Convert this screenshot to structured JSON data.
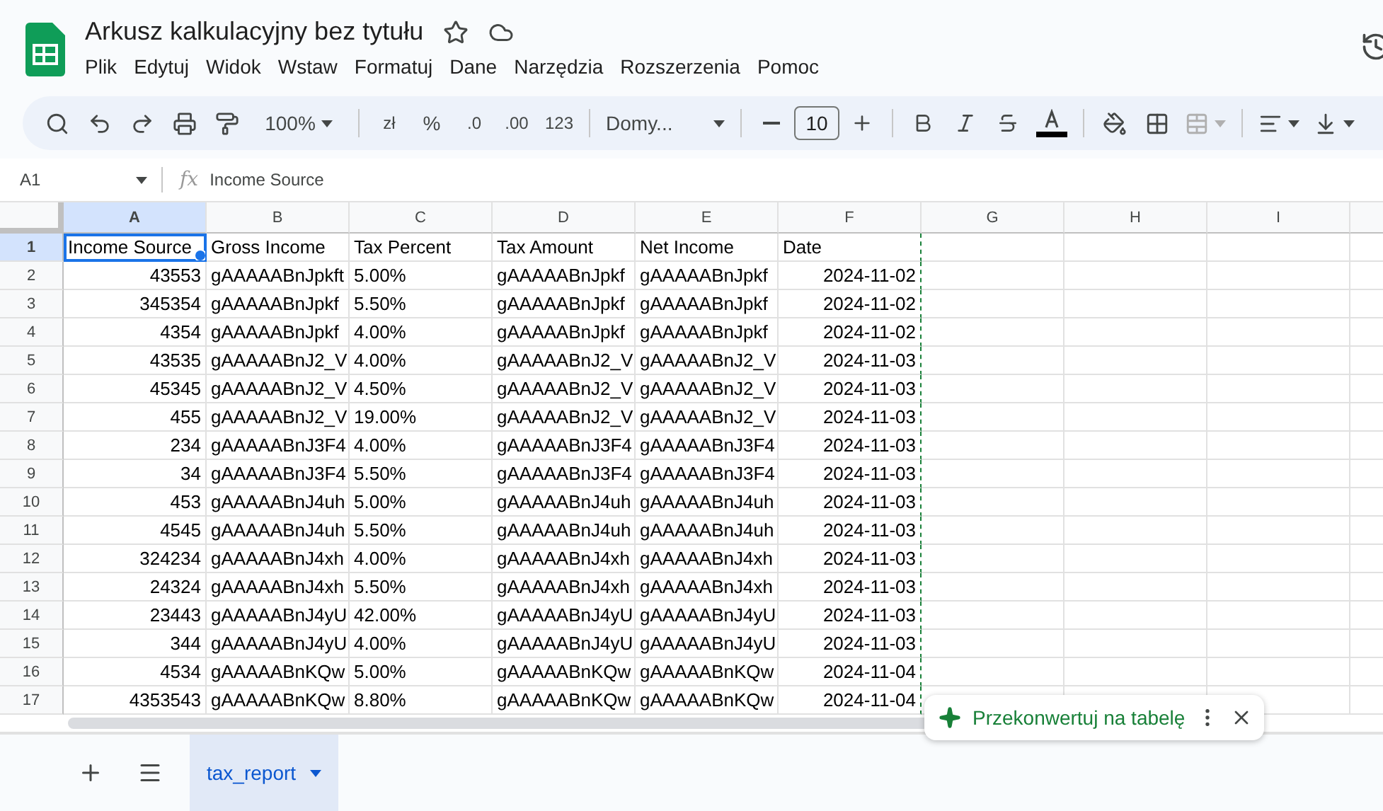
{
  "document": {
    "title": "Arkusz kalkulacyjny bez tytułu"
  },
  "menu": [
    "Plik",
    "Edytuj",
    "Widok",
    "Wstaw",
    "Formatuj",
    "Dane",
    "Narzędzia",
    "Rozszerzenia",
    "Pomoc"
  ],
  "toolbar": {
    "zoom": "100%",
    "currency": "zł",
    "percent": "%",
    "decrease_decimals": ".0",
    "increase_decimals": ".00",
    "number_format": "123",
    "font": "Domy...",
    "font_size": "10"
  },
  "formula_bar": {
    "cell_ref": "A1",
    "function_label": "fx",
    "formula": "Income Source"
  },
  "grid": {
    "columns": [
      {
        "label": "A",
        "selected": true
      },
      {
        "label": "B",
        "selected": false
      },
      {
        "label": "C",
        "selected": false
      },
      {
        "label": "D",
        "selected": false
      },
      {
        "label": "E",
        "selected": false
      },
      {
        "label": "F",
        "selected": false
      },
      {
        "label": "G",
        "selected": false
      },
      {
        "label": "H",
        "selected": false
      },
      {
        "label": "I",
        "selected": false
      }
    ],
    "rows": [
      {
        "number": "1",
        "selected": true,
        "cells": [
          {
            "text": "Income Source",
            "kind": "text"
          },
          {
            "text": "Gross Income",
            "kind": "text"
          },
          {
            "text": "Tax Percent",
            "kind": "text"
          },
          {
            "text": "Tax Amount",
            "kind": "text"
          },
          {
            "text": "Net Income",
            "kind": "text"
          },
          {
            "text": "Date",
            "kind": "text"
          }
        ]
      },
      {
        "number": "2",
        "selected": false,
        "cells": [
          {
            "text": "43553",
            "kind": "number"
          },
          {
            "text": "gAAAAABnJpkft",
            "kind": "text"
          },
          {
            "text": "5.00%",
            "kind": "text"
          },
          {
            "text": "gAAAAABnJpkf",
            "kind": "text"
          },
          {
            "text": "gAAAAABnJpkf",
            "kind": "text"
          },
          {
            "text": "2024-11-02",
            "kind": "number"
          }
        ]
      },
      {
        "number": "3",
        "selected": false,
        "cells": [
          {
            "text": "345354",
            "kind": "number"
          },
          {
            "text": "gAAAAABnJpkf",
            "kind": "text"
          },
          {
            "text": "5.50%",
            "kind": "text"
          },
          {
            "text": "gAAAAABnJpkf",
            "kind": "text"
          },
          {
            "text": "gAAAAABnJpkf",
            "kind": "text"
          },
          {
            "text": "2024-11-02",
            "kind": "number"
          }
        ]
      },
      {
        "number": "4",
        "selected": false,
        "cells": [
          {
            "text": "4354",
            "kind": "number"
          },
          {
            "text": "gAAAAABnJpkf",
            "kind": "text"
          },
          {
            "text": "4.00%",
            "kind": "text"
          },
          {
            "text": "gAAAAABnJpkf",
            "kind": "text"
          },
          {
            "text": "gAAAAABnJpkf",
            "kind": "text"
          },
          {
            "text": "2024-11-02",
            "kind": "number"
          }
        ]
      },
      {
        "number": "5",
        "selected": false,
        "cells": [
          {
            "text": "43535",
            "kind": "number"
          },
          {
            "text": "gAAAAABnJ2_V",
            "kind": "text"
          },
          {
            "text": "4.00%",
            "kind": "text"
          },
          {
            "text": "gAAAAABnJ2_V",
            "kind": "text"
          },
          {
            "text": "gAAAAABnJ2_V",
            "kind": "text"
          },
          {
            "text": "2024-11-03",
            "kind": "number"
          }
        ]
      },
      {
        "number": "6",
        "selected": false,
        "cells": [
          {
            "text": "45345",
            "kind": "number"
          },
          {
            "text": "gAAAAABnJ2_V",
            "kind": "text"
          },
          {
            "text": "4.50%",
            "kind": "text"
          },
          {
            "text": "gAAAAABnJ2_V",
            "kind": "text"
          },
          {
            "text": "gAAAAABnJ2_V",
            "kind": "text"
          },
          {
            "text": "2024-11-03",
            "kind": "number"
          }
        ]
      },
      {
        "number": "7",
        "selected": false,
        "cells": [
          {
            "text": "455",
            "kind": "number"
          },
          {
            "text": "gAAAAABnJ2_V",
            "kind": "text"
          },
          {
            "text": "19.00%",
            "kind": "text"
          },
          {
            "text": "gAAAAABnJ2_V",
            "kind": "text"
          },
          {
            "text": "gAAAAABnJ2_V",
            "kind": "text"
          },
          {
            "text": "2024-11-03",
            "kind": "number"
          }
        ]
      },
      {
        "number": "8",
        "selected": false,
        "cells": [
          {
            "text": "234",
            "kind": "number"
          },
          {
            "text": "gAAAAABnJ3F4",
            "kind": "text"
          },
          {
            "text": "4.00%",
            "kind": "text"
          },
          {
            "text": "gAAAAABnJ3F4",
            "kind": "text"
          },
          {
            "text": "gAAAAABnJ3F4",
            "kind": "text"
          },
          {
            "text": "2024-11-03",
            "kind": "number"
          }
        ]
      },
      {
        "number": "9",
        "selected": false,
        "cells": [
          {
            "text": "34",
            "kind": "number"
          },
          {
            "text": "gAAAAABnJ3F4",
            "kind": "text"
          },
          {
            "text": "5.50%",
            "kind": "text"
          },
          {
            "text": "gAAAAABnJ3F4",
            "kind": "text"
          },
          {
            "text": "gAAAAABnJ3F4",
            "kind": "text"
          },
          {
            "text": "2024-11-03",
            "kind": "number"
          }
        ]
      },
      {
        "number": "10",
        "selected": false,
        "cells": [
          {
            "text": "453",
            "kind": "number"
          },
          {
            "text": "gAAAAABnJ4uh",
            "kind": "text"
          },
          {
            "text": "5.00%",
            "kind": "text"
          },
          {
            "text": "gAAAAABnJ4uh",
            "kind": "text"
          },
          {
            "text": "gAAAAABnJ4uh",
            "kind": "text"
          },
          {
            "text": "2024-11-03",
            "kind": "number"
          }
        ]
      },
      {
        "number": "11",
        "selected": false,
        "cells": [
          {
            "text": "4545",
            "kind": "number"
          },
          {
            "text": "gAAAAABnJ4uh",
            "kind": "text"
          },
          {
            "text": "5.50%",
            "kind": "text"
          },
          {
            "text": "gAAAAABnJ4uh",
            "kind": "text"
          },
          {
            "text": "gAAAAABnJ4uh",
            "kind": "text"
          },
          {
            "text": "2024-11-03",
            "kind": "number"
          }
        ]
      },
      {
        "number": "12",
        "selected": false,
        "cells": [
          {
            "text": "324234",
            "kind": "number"
          },
          {
            "text": "gAAAAABnJ4xh",
            "kind": "text"
          },
          {
            "text": "4.00%",
            "kind": "text"
          },
          {
            "text": "gAAAAABnJ4xh",
            "kind": "text"
          },
          {
            "text": "gAAAAABnJ4xh",
            "kind": "text"
          },
          {
            "text": "2024-11-03",
            "kind": "number"
          }
        ]
      },
      {
        "number": "13",
        "selected": false,
        "cells": [
          {
            "text": "24324",
            "kind": "number"
          },
          {
            "text": "gAAAAABnJ4xh",
            "kind": "text"
          },
          {
            "text": "5.50%",
            "kind": "text"
          },
          {
            "text": "gAAAAABnJ4xh",
            "kind": "text"
          },
          {
            "text": "gAAAAABnJ4xh",
            "kind": "text"
          },
          {
            "text": "2024-11-03",
            "kind": "number"
          }
        ]
      },
      {
        "number": "14",
        "selected": false,
        "cells": [
          {
            "text": "23443",
            "kind": "number"
          },
          {
            "text": "gAAAAABnJ4yU",
            "kind": "text"
          },
          {
            "text": "42.00%",
            "kind": "text"
          },
          {
            "text": "gAAAAABnJ4yU",
            "kind": "text"
          },
          {
            "text": "gAAAAABnJ4yU",
            "kind": "text"
          },
          {
            "text": "2024-11-03",
            "kind": "number"
          }
        ]
      },
      {
        "number": "15",
        "selected": false,
        "cells": [
          {
            "text": "344",
            "kind": "number"
          },
          {
            "text": "gAAAAABnJ4yU",
            "kind": "text"
          },
          {
            "text": "4.00%",
            "kind": "text"
          },
          {
            "text": "gAAAAABnJ4yU",
            "kind": "text"
          },
          {
            "text": "gAAAAABnJ4yU",
            "kind": "text"
          },
          {
            "text": "2024-11-03",
            "kind": "number"
          }
        ]
      },
      {
        "number": "16",
        "selected": false,
        "cells": [
          {
            "text": "4534",
            "kind": "number"
          },
          {
            "text": "gAAAAABnKQw",
            "kind": "text"
          },
          {
            "text": "5.00%",
            "kind": "text"
          },
          {
            "text": "gAAAAABnKQw",
            "kind": "text"
          },
          {
            "text": "gAAAAABnKQw",
            "kind": "text"
          },
          {
            "text": "2024-11-04",
            "kind": "number"
          }
        ]
      },
      {
        "number": "17",
        "selected": false,
        "cells": [
          {
            "text": "4353543",
            "kind": "number"
          },
          {
            "text": "gAAAAABnKQw",
            "kind": "text"
          },
          {
            "text": "8.80%",
            "kind": "text"
          },
          {
            "text": "gAAAAABnKQw",
            "kind": "text"
          },
          {
            "text": "gAAAAABnKQw",
            "kind": "text"
          },
          {
            "text": "2024-11-04",
            "kind": "number"
          }
        ]
      }
    ]
  },
  "toast": {
    "text": "Przekonwertuj na tabelę"
  },
  "sheet_tabs": [
    {
      "label": "tax_report",
      "selected": true
    }
  ]
}
